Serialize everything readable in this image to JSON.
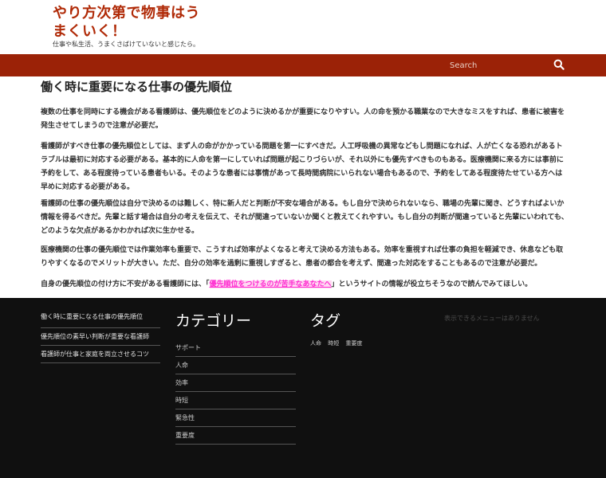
{
  "header": {
    "site_title": "やり方次第で物事はうまくいく！",
    "site_description": "仕事や私生活、うまくさばけていないと感じたら。"
  },
  "nav": {
    "search_placeholder": "Search",
    "search_icon": "search-icon"
  },
  "article": {
    "title": "働く時に重要になる仕事の優先順位",
    "paragraphs": [
      "複数の仕事を同時にする機会がある看護師は、優先順位をどのように決めるかが重要になりやすい。人の命を預かる職業なので大きなミスをすれば、患者に被害を発生させてしまうので注意が必要だ。",
      "看護師がすべき仕事の優先順位としては、まず人の命がかかっている問題を第一にすべきだ。人工呼吸機の異常などもし問題になれば、人が亡くなる恐れがあるトラブルは最初に対応する必要がある。基本的に人命を第一にしていれば問題が起こりづらいが、それ以外にも優先すべきものもある。医療機関に来る方には事前に予約をして、ある程度待っている患者もいる。そのような患者には事情があって長時間病院にいられない場合もあるので、予約をしてある程度待たせている方へは早めに対応する必要がある。",
      "看護師の仕事の優先順位は自分で決めるのは難しく、特に新人だと判断が不安な場合がある。もし自分で決められないなら、職場の先輩に聞き、どうすればよいか情報を得るべきだ。先輩と話す場合は自分の考えを伝えて、それが間違っていないか聞くと教えてくれやすい。もし自分の判断が間違っていると先輩にいわれても、どのような欠点があるかわかれば次に生かせる。",
      "医療機関の仕事の優先順位では作業効率も重要で、こうすれば効率がよくなると考えて決める方法もある。効率を重視すれば仕事の負担を軽減でき、休息なども取りやすくなるのでメリットが大きい。ただ、自分の効率を過剰に重視しすぎると、患者の都合を考えず、間違った対応をすることもあるので注意が必要だ。"
    ],
    "last_before": "自身の優先順位の付け方に不安がある看護師には、「",
    "last_link": "優先順位をつけるのが苦手なあなたへ",
    "last_after": "」というサイトの情報が役立ちそうなので読んでみてほしい。"
  },
  "footer": {
    "recent_posts": [
      "働く時に重要になる仕事の優先順位",
      "優先順位の素早い判断が重要な看護師",
      "看護師が仕事と家庭を両立させるコツ"
    ],
    "category_heading": "カテゴリー",
    "categories": [
      "サポート",
      "人命",
      "効率",
      "時短",
      "緊急性",
      "重要度"
    ],
    "tag_heading": "タグ",
    "tags": [
      "人命",
      "時短",
      "重要度"
    ],
    "empty_widget_text": "表示できるメニューはありません"
  },
  "colors": {
    "brand": "#b02a07",
    "navbar": "#9b2207",
    "link_highlight": "#ff2ad0",
    "footer_bg": "#101010"
  }
}
